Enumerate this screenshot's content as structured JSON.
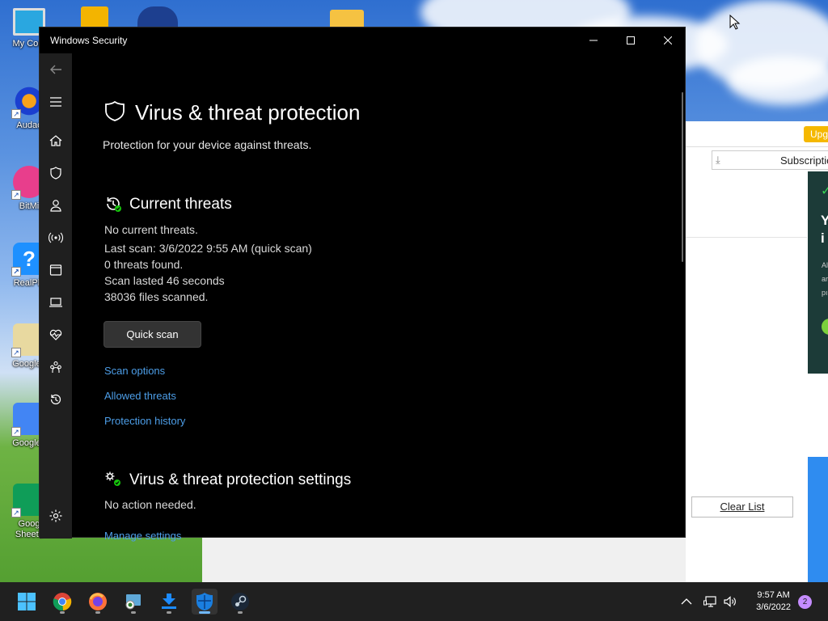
{
  "desktop": {
    "icons": [
      {
        "label": "My Com"
      },
      {
        "label": "Audac"
      },
      {
        "label": "BitMi"
      },
      {
        "label": "RealPla"
      },
      {
        "label": "Google I"
      },
      {
        "label": "Google I"
      },
      {
        "label": "Goog Sheets"
      }
    ]
  },
  "background_app": {
    "upgrade_label": "Upg",
    "subscription_label": "Subscriptic",
    "clear_list_label": "Clear List",
    "ad_text": "Y i",
    "ad_small": "Al ar pı"
  },
  "window": {
    "title": "Windows Security",
    "page_title": "Virus & threat protection",
    "subtitle": "Protection for your device against threats.",
    "current_threats": {
      "heading": "Current threats",
      "lines": [
        "No current threats.",
        "Last scan: 3/6/2022 9:55 AM (quick scan)",
        "0 threats found.",
        "Scan lasted 46 seconds",
        "38036 files scanned."
      ],
      "quick_scan_label": "Quick scan",
      "links": [
        "Scan options",
        "Allowed threats",
        "Protection history"
      ]
    },
    "settings": {
      "heading": "Virus & threat protection settings",
      "status": "No action needed.",
      "link": "Manage settings"
    }
  },
  "taskbar": {
    "apps": [
      "start",
      "chrome",
      "firefox",
      "network-share",
      "downloader",
      "windows-security",
      "steam"
    ],
    "time": "9:57 AM",
    "date": "3/6/2022",
    "notification_count": "2"
  },
  "colors": {
    "link": "#4d9ee8",
    "window_bg": "#000000",
    "nav_bg": "#1f1f1f",
    "taskbar_bg": "#202020",
    "status_ok": "#16c60c"
  }
}
